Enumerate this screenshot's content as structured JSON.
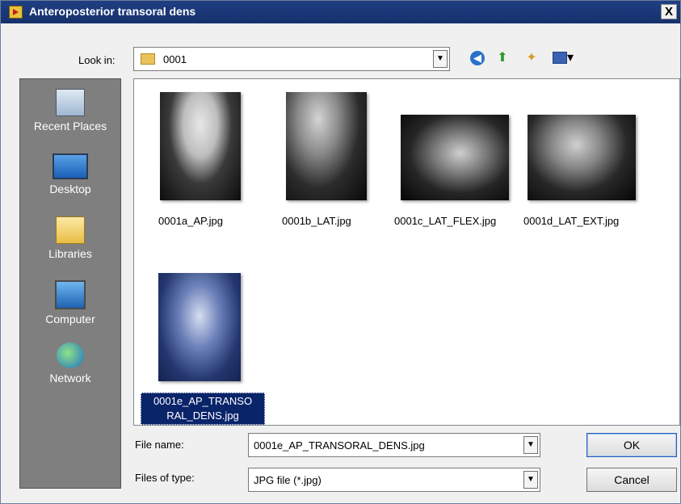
{
  "window": {
    "title": "Anteroposterior transoral dens",
    "close_label": "X"
  },
  "lookin": {
    "label": "Look in:",
    "value": "0001"
  },
  "toolbar": {
    "back_icon": "back-arrow-icon",
    "up_icon": "up-folder-icon",
    "new_folder_icon": "new-folder-icon",
    "views_icon": "views-menu-icon"
  },
  "places": [
    {
      "label": "Recent Places",
      "icon": "recent-places-icon"
    },
    {
      "label": "Desktop",
      "icon": "desktop-icon"
    },
    {
      "label": "Libraries",
      "icon": "libraries-icon"
    },
    {
      "label": "Computer",
      "icon": "computer-icon"
    },
    {
      "label": "Network",
      "icon": "network-icon"
    }
  ],
  "files": [
    {
      "name": "0001a_AP.jpg"
    },
    {
      "name": "0001b_LAT.jpg"
    },
    {
      "name": "0001c_LAT_FLEX.jpg"
    },
    {
      "name": "0001d_LAT_EXT.jpg"
    },
    {
      "name": "0001e_AP_TRANSORAL_DENS.jpg",
      "name_line1": "0001e_AP_TRANSO",
      "name_line2": "RAL_DENS.jpg",
      "selected": true
    }
  ],
  "form": {
    "file_name_label": "File name:",
    "file_name_value": "0001e_AP_TRANSORAL_DENS.jpg",
    "file_type_label": "Files of type:",
    "file_type_value": "JPG file (*.jpg)"
  },
  "buttons": {
    "ok": "OK",
    "cancel": "Cancel"
  },
  "colors": {
    "titlebar": "#1f3f83",
    "selection": "#0a246a",
    "places_panel": "#7f7f7f"
  }
}
